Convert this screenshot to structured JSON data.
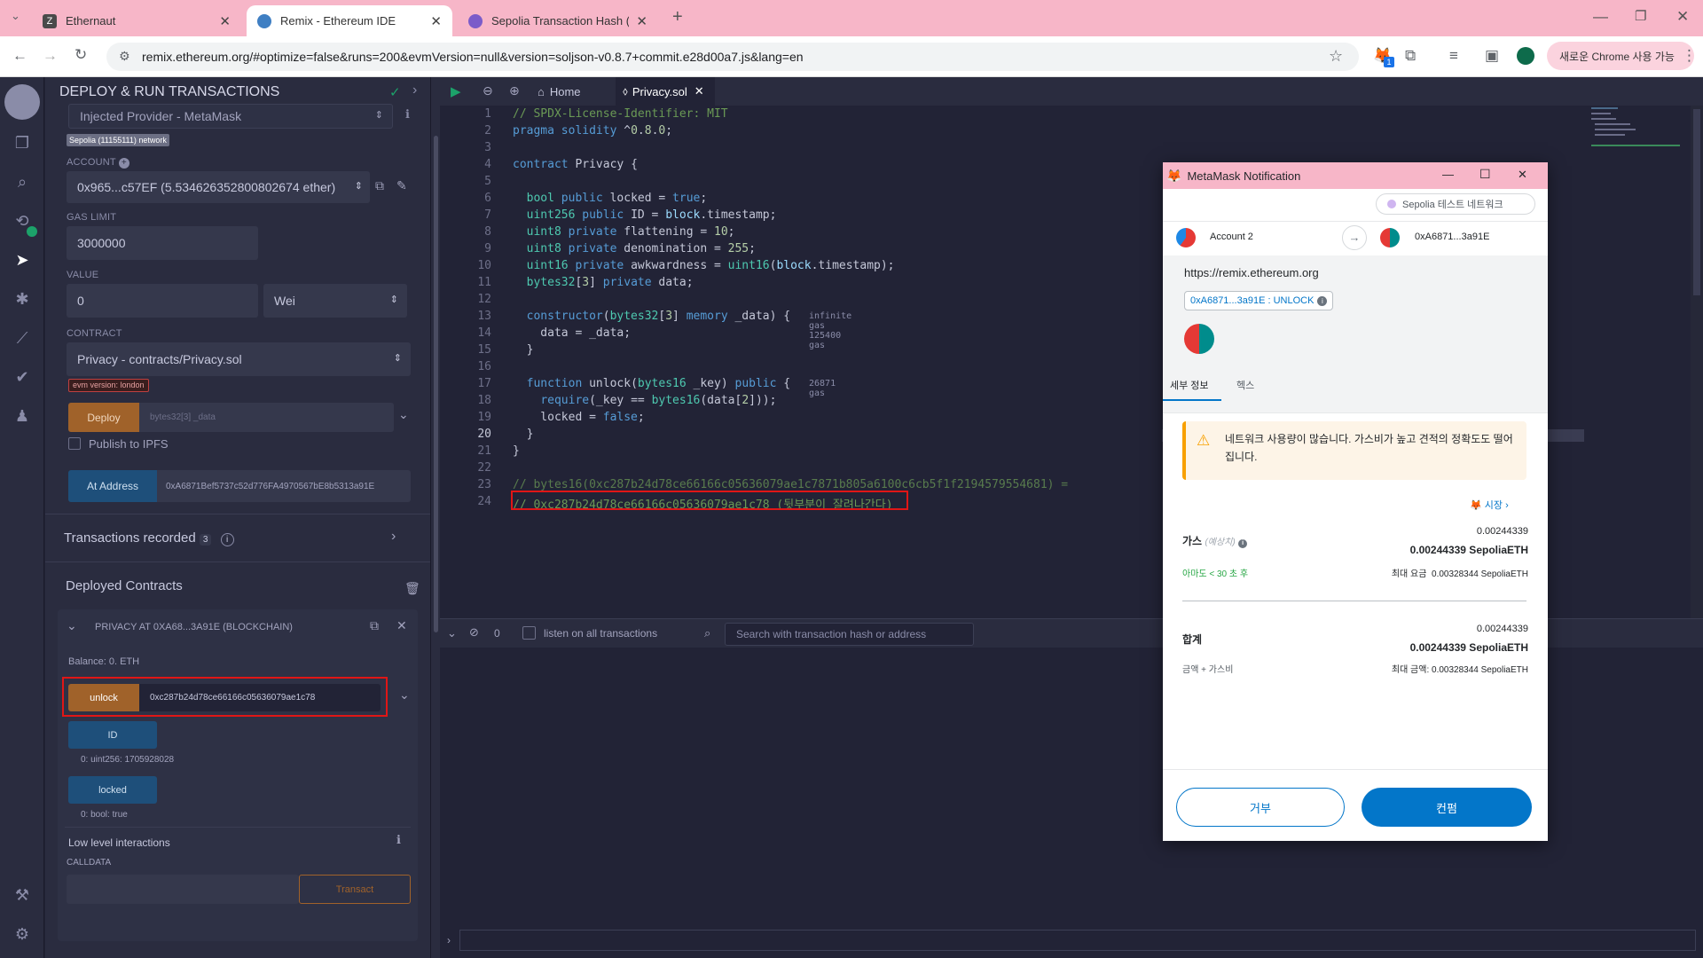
{
  "browser": {
    "tabs": [
      {
        "title": "Ethernaut",
        "fav": "#4a4a4a",
        "favtext": "Z"
      },
      {
        "title": "Remix - Ethereum IDE",
        "fav": "#3f7fc3",
        "favtext": ""
      },
      {
        "title": "Sepolia Transaction Hash (Txha",
        "fav": "#7b5cc9",
        "favtext": ""
      }
    ],
    "url": "remix.ethereum.org/#optimize=false&runs=200&evmVersion=null&version=soljson-v0.8.7+commit.e28d00a7.js&lang=en",
    "update_label": "새로운 Chrome 사용 가능",
    "extension_badge": "1"
  },
  "sidepanel": {
    "title": "DEPLOY & RUN TRANSACTIONS",
    "environment": "Injected Provider - MetaMask",
    "network_badge": "Sepolia (11155111) network",
    "account_label": "ACCOUNT",
    "account_value": "0x965...c57EF (5.534626352800802674 ether)",
    "gas_limit_label": "GAS LIMIT",
    "gas_limit_value": "3000000",
    "value_label": "VALUE",
    "value_amount": "0",
    "value_unit": "Wei",
    "contract_label": "CONTRACT",
    "contract_value": "Privacy - contracts/Privacy.sol",
    "evm_badge": "evm version: london",
    "deploy_label": "Deploy",
    "deploy_param_placeholder": "bytes32[3] _data",
    "publish_label": "Publish to IPFS",
    "at_address_label": "At Address",
    "at_address_value": "0xA6871Bef5737c52d776FA4970567bE8b5313a91E",
    "transactions_recorded_label": "Transactions recorded",
    "transactions_recorded_count": "3",
    "deployed_contracts_label": "Deployed Contracts",
    "instance_title": "PRIVACY AT 0XA68...3A91E (BLOCKCHAIN)",
    "balance": "Balance: 0. ETH",
    "unlock_label": "unlock",
    "unlock_value": "0xc287b24d78ce66166c05636079ae1c78",
    "id_label": "ID",
    "id_result": "0: uint256: 1705928028",
    "locked_label": "locked",
    "locked_result": "0: bool: true",
    "low_level_label": "Low level interactions",
    "calldata_label": "CALLDATA",
    "transact_label": "Transact"
  },
  "editor": {
    "home_tab": "Home",
    "file_tab": "Privacy.sol",
    "gas_hint_constructor": "infinite gas 125400 gas",
    "gas_hint_unlock": "26871 gas",
    "lines": [
      "// SPDX-License-Identifier: MIT",
      "pragma solidity ^0.8.0;",
      "",
      "contract Privacy {",
      "",
      "  bool public locked = true;",
      "  uint256 public ID = block.timestamp;",
      "  uint8 private flattening = 10;",
      "  uint8 private denomination = 255;",
      "  uint16 private awkwardness = uint16(block.timestamp);",
      "  bytes32[3] private data;",
      "",
      "  constructor(bytes32[3] memory _data) {",
      "    data = _data;",
      "  }",
      "",
      "  function unlock(bytes16 _key) public {",
      "    require(_key == bytes16(data[2]));",
      "    locked = false;",
      "  }",
      "}",
      "",
      "// bytes16(0xc287b24d78ce66166c05636079ae1c7871b805a6100c6cb5f1f2194579554681) =",
      "// 0xc287b24d78ce66166c05636079ae1c78 (뒷부분이 잘려나간다)"
    ]
  },
  "terminal": {
    "count": "0",
    "listen_label": "listen on all transactions",
    "search_placeholder": "Search with transaction hash or address"
  },
  "metamask": {
    "title": "MetaMask Notification",
    "network": "Sepolia 테스트 네트워크",
    "from_account": "Account 2",
    "to_address": "0xA6871...3a91E",
    "origin": "https://remix.ethereum.org",
    "method_chip": "0xA6871...3a91E : UNLOCK",
    "tab_details": "세부 정보",
    "tab_hex": "헥스",
    "warning": "네트워크 사용량이 많습니다. 가스비가 높고 견적의 정확도도 떨어집니다.",
    "market_label": "시장",
    "gas_label": "가스",
    "gas_estimated": "(예상치)",
    "gas_value_small": "0.00244339",
    "gas_value": "0.00244339 SepoliaETH",
    "gas_eta": "아마도 < 30 초 후",
    "max_fee_label": "최대 요금",
    "max_fee_value": "0.00328344 SepoliaETH",
    "total_label": "합계",
    "total_value_small": "0.00244339",
    "total_value": "0.00244339 SepoliaETH",
    "total_sub": "금액 + 가스비",
    "max_amount_label": "최대 금액:",
    "max_amount_value": "0.00328344 SepoliaETH",
    "reject_label": "거부",
    "confirm_label": "컨펌"
  },
  "colors": {
    "accent_red": "#e01616",
    "deploy_orange": "#a0622a",
    "call_blue": "#1e4f7a",
    "mm_blue": "#0376c9"
  }
}
